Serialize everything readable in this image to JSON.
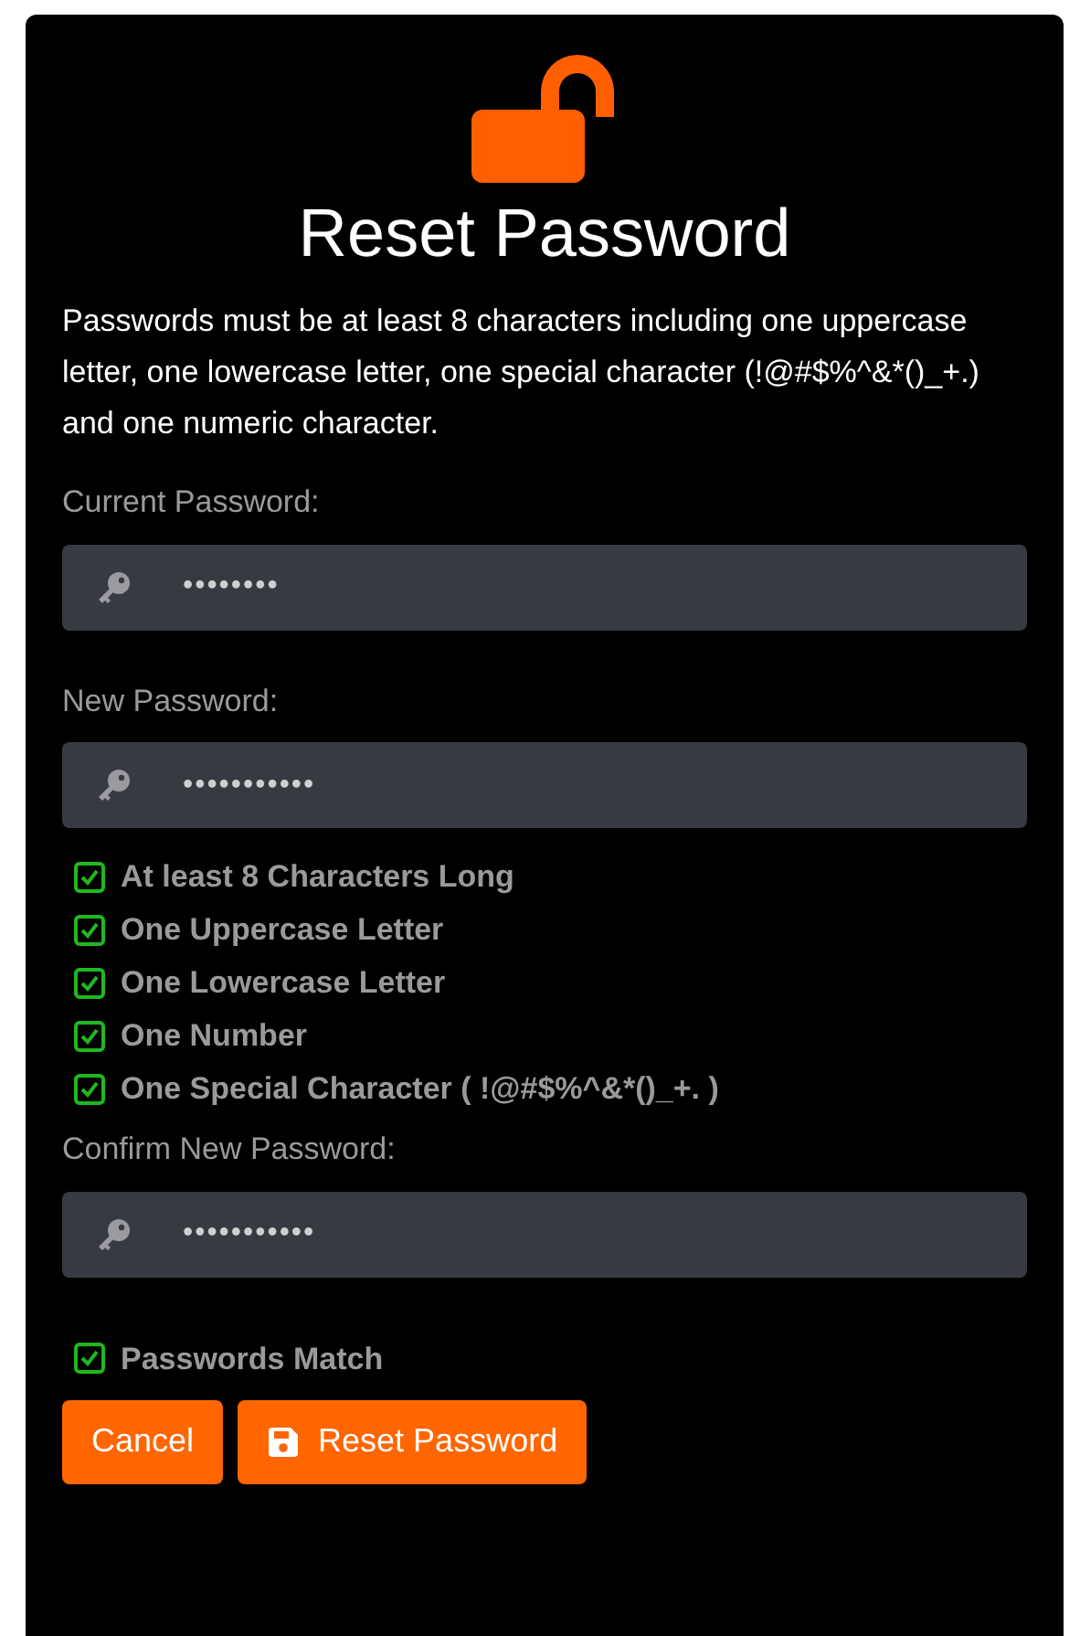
{
  "title": "Reset Password",
  "instructions": "Passwords must be at least 8 characters including one uppercase letter, one lowercase letter, one special character (!@#$%^&*()_+.) and one numeric character.",
  "current_password": {
    "label": "Current Password:",
    "value": "••••••••"
  },
  "new_password": {
    "label": "New Password:",
    "value": "•••••••••••"
  },
  "requirements": [
    {
      "text": "At least 8 Characters Long",
      "checked": true
    },
    {
      "text": "One Uppercase Letter",
      "checked": true
    },
    {
      "text": "One Lowercase Letter",
      "checked": true
    },
    {
      "text": "One Number",
      "checked": true
    },
    {
      "text": "One Special Character ( !@#$%^&*()_+. )",
      "checked": true
    }
  ],
  "confirm_password": {
    "label": "Confirm New Password:",
    "value": "•••••••••••"
  },
  "match": {
    "text": "Passwords Match",
    "checked": true
  },
  "buttons": [
    {
      "label": "Cancel",
      "kind": "plain"
    },
    {
      "label": "Reset Password",
      "kind": "save"
    }
  ]
}
